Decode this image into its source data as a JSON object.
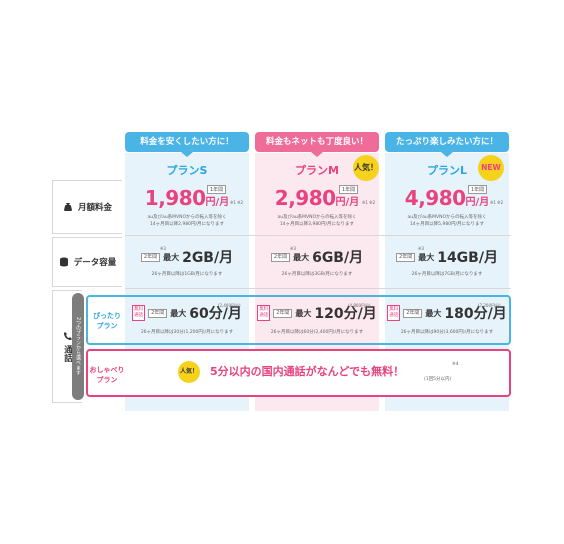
{
  "taglines": {
    "s": "料金を安くしたい方に！",
    "m": "料金もネットも丁度良い！",
    "l": "たっぷり楽しみたい方に！"
  },
  "plans": {
    "s": {
      "name": "プランS",
      "price": "1,980",
      "unit": "円/月",
      "year_tag": "1年間",
      "note_marks": "※1 ※2",
      "note": "au及びau系MVNOからの転入等を除く\n14ヶ月目以降2,980円/月になります",
      "data_tag": "2年間",
      "data_max": "最大",
      "data_val": "2GB/月",
      "data_mark": "※3",
      "data_note": "26ヶ月目以降は1GB/月になります",
      "call_tag": "2年間",
      "call_max": "最大",
      "call_val": "60分/月",
      "call_sub": "(2,400円分)",
      "call_note": "26ヶ月目以降は30分(1,200円)/月になります"
    },
    "m": {
      "name": "プランM",
      "price": "2,980",
      "unit": "円/月",
      "year_tag": "1年間",
      "note_marks": "※1 ※2",
      "note": "au及びau系MVNOからの転入等を除く\n14ヶ月目以降3,980円/月になります",
      "data_tag": "2年間",
      "data_max": "最大",
      "data_val": "6GB/月",
      "data_mark": "※3",
      "data_note": "26ヶ月目以降は3GB/月になります",
      "call_tag": "2年間",
      "call_max": "最大",
      "call_val": "120分/月",
      "call_sub": "(4,800円分)",
      "call_note": "26ヶ月目以降は60分(2,400円)/月になります"
    },
    "l": {
      "name": "プランL",
      "price": "4,980",
      "unit": "円/月",
      "year_tag": "1年間",
      "note_marks": "※1 ※2",
      "note": "au及びau系MVNOからの転入等を除く\n14ヶ月目以降5,980円/月になります",
      "data_tag": "2年間",
      "data_max": "最大",
      "data_val": "14GB/月",
      "data_mark": "※3",
      "data_note": "26ヶ月目以降は7GB/月になります",
      "call_tag": "2年間",
      "call_max": "最大",
      "call_val": "180分/月",
      "call_sub": "(7,200円分)",
      "call_note": "26ヶ月目以降は90分(3,600円)/月になります"
    }
  },
  "badges": {
    "popular": "人気！",
    "new": "NEW"
  },
  "rows": {
    "fee": "月額料金",
    "data": "データ容量",
    "call": "通話"
  },
  "call": {
    "side": "2つのプランから選べます",
    "fit_label": "ぴったり\nプラン",
    "talk_label": "おしゃべり\nプラン",
    "free_badge": "無料\n通話",
    "talk_badge": "人気！",
    "talk_text": "5分以内の国内通話がなんどでも無料！",
    "talk_mark": "※4",
    "talk_note": "(1回5分以内)"
  },
  "colors": {
    "blue": "#4ab4e6",
    "pink": "#e8427f",
    "yellow": "#f6d21c"
  }
}
